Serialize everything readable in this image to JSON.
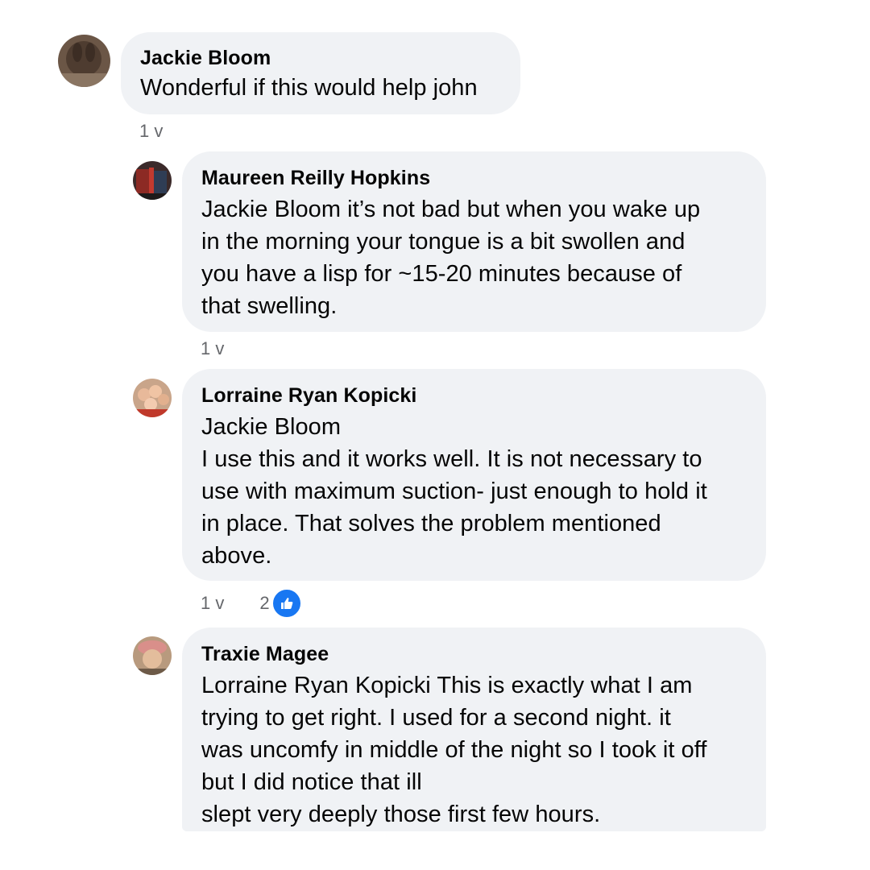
{
  "comments": [
    {
      "name": "Jackie Bloom",
      "lines": [
        "Wonderful if this would help john"
      ],
      "time": "1 v"
    },
    {
      "name": "Maureen Reilly Hopkins",
      "lines": [
        "Jackie Bloom it’s not bad but when you wake up",
        "in the morning your tongue is a bit swollen and",
        "you have a lisp for ~15-20 minutes because of",
        "that swelling."
      ],
      "time": "1 v"
    },
    {
      "name": "Lorraine Ryan Kopicki",
      "lines": [
        "Jackie Bloom",
        "I use this and it works well. It is not necessary to",
        "use with maximum suction- just enough to hold it",
        "in place. That solves the problem mentioned",
        "above."
      ],
      "time": "1 v",
      "likes": "2"
    },
    {
      "name": "Traxie Magee",
      "lines": [
        "Lorraine Ryan Kopicki This is exactly what I am",
        "trying to get right. I used for a second night. it",
        "was uncomfy in middle of the night so I took it off",
        "but I did notice that ill",
        "slept very deeply those first few hours."
      ]
    }
  ],
  "icons": {
    "like": "thumbs-up-icon"
  },
  "colors": {
    "bubble": "#f0f2f5",
    "meta": "#65676b",
    "like": "#1877f2"
  }
}
